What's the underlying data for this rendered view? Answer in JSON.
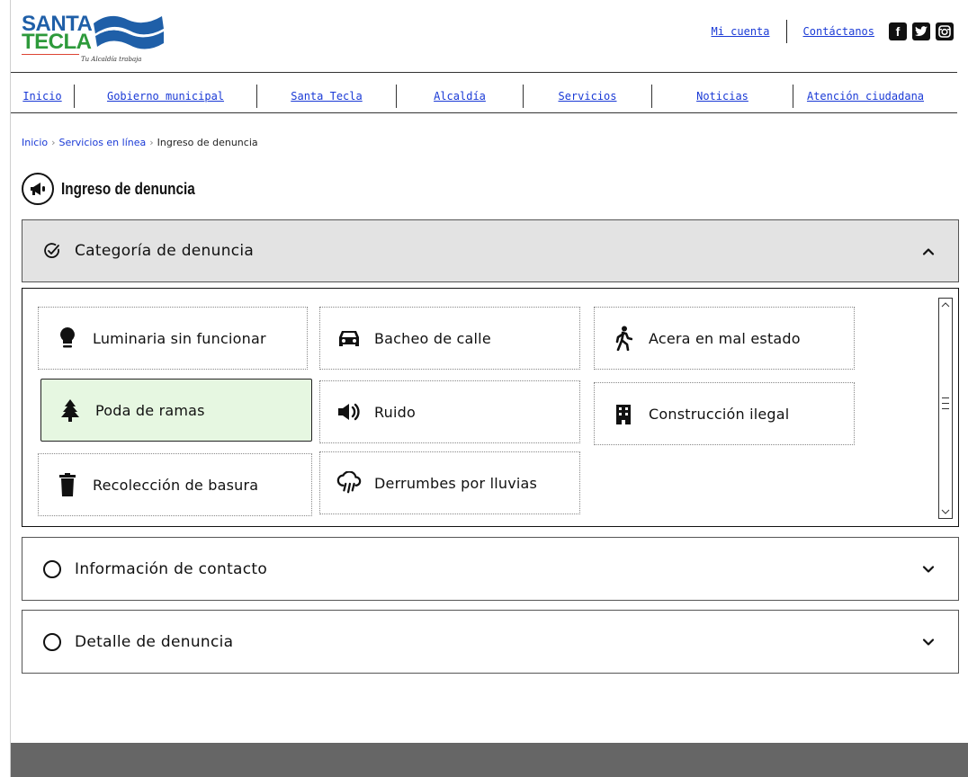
{
  "brand": {
    "line1": "SANTA",
    "line2": "TECLA",
    "tagline": "Tu Alcaldía trabaja"
  },
  "toplinks": {
    "account": "Mi cuenta",
    "contact": "Contáctanos"
  },
  "social": {
    "facebook": "f",
    "twitter": "t",
    "instagram": "ig"
  },
  "nav": [
    "Inicio",
    "Gobierno municipal",
    "Santa Tecla",
    "Alcaldía",
    "Servicios",
    "Noticias",
    "Atención ciudadana"
  ],
  "breadcrumb": {
    "home": "Inicio",
    "section": "Servicios en línea",
    "current": "Ingreso de denuncia"
  },
  "page": {
    "title": "Ingreso de denuncia",
    "icon": "megaphone-icon"
  },
  "sections": {
    "category": {
      "title": "Categoría de denuncia",
      "state": "expanded"
    },
    "contact": {
      "title": "Información de contacto",
      "state": "collapsed"
    },
    "detail": {
      "title": "Detalle de denuncia",
      "state": "collapsed"
    }
  },
  "categories": [
    {
      "label": "Luminaria sin funcionar",
      "icon": "lightbulb-icon",
      "selected": false
    },
    {
      "label": "Bacheo de calle",
      "icon": "car-icon",
      "selected": false
    },
    {
      "label": "Acera en mal estado",
      "icon": "walking-person-icon",
      "selected": false
    },
    {
      "label": "Poda de ramas",
      "icon": "tree-icon",
      "selected": true
    },
    {
      "label": "Ruido",
      "icon": "speaker-icon",
      "selected": false
    },
    {
      "label": "Construcción ilegal",
      "icon": "building-icon",
      "selected": false
    },
    {
      "label": "Recolección de basura",
      "icon": "trash-icon",
      "selected": false
    },
    {
      "label": "Derrumbes por lluvias",
      "icon": "rain-cloud-icon",
      "selected": false
    }
  ],
  "colors": {
    "link": "#1a3ad6",
    "selected_bg": "#e6f7e1",
    "header_bg": "#e3e3e3",
    "footer_bg": "#666666"
  }
}
